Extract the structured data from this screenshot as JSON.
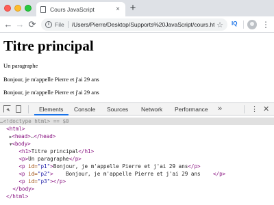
{
  "browser": {
    "tab_title": "Cours JavaScript",
    "tab_close": "×",
    "new_tab": "+",
    "nav": {
      "back": "←",
      "forward": "→",
      "reload": "⟳"
    },
    "omnibox": {
      "info": "i",
      "scheme_label": "File",
      "url": "/Users/Pierre/Desktop/Supports%20JavaScript/cours.html",
      "star": "☆"
    },
    "extension_label": "IQ",
    "menu": "⋮"
  },
  "page": {
    "h1": "Titre principal",
    "paragraphs": [
      "Un paragraphe",
      "Bonjour, je m'appelle Pierre et j'ai 29 ans",
      "Bonjour, je m'appelle Pierre et j'ai 29 ans"
    ]
  },
  "devtools": {
    "tabs": [
      "Elements",
      "Console",
      "Sources",
      "Network",
      "Performance"
    ],
    "active_tab": "Elements",
    "more": "»",
    "kebab": "⋮",
    "close": "✕",
    "dom": {
      "doctype": "<!doctype html>",
      "selected_marker": "== $0",
      "html_open": "<html>",
      "head": "<head>",
      "head_ellipsis": "…",
      "head_close": "</head>",
      "body_open": "<body>",
      "h1_open": "<h1>",
      "h1_text": "Titre principal",
      "h1_close": "</h1>",
      "p_open": "<p>",
      "p_text": "Un paragraphe",
      "p_close": "</p>",
      "p1_open": "<p ",
      "p1_attr": "id=",
      "p1_val": "\"p1\"",
      "p1_gt": ">",
      "p1_text": "Bonjour, je m'appelle Pierre et j'ai 29 ans",
      "p1_close": "</p>",
      "p2_open": "<p ",
      "p2_attr": "id=",
      "p2_val": "\"p2\"",
      "p2_gt": ">",
      "p2_text": "    Bonjour, je m'appelle Pierre et j'ai 29 ans    ",
      "p2_close": "</p>",
      "p3_open": "<p ",
      "p3_attr": "id=",
      "p3_val": "\"p3\"",
      "p3_gt": ">",
      "p3_close": "</p>",
      "body_close": "</body>",
      "html_close": "</html>"
    }
  },
  "colors": {
    "tag": "#881280",
    "attr_name": "#994500",
    "attr_value": "#1a1aa6",
    "active_tab_underline": "#1a73e8"
  }
}
